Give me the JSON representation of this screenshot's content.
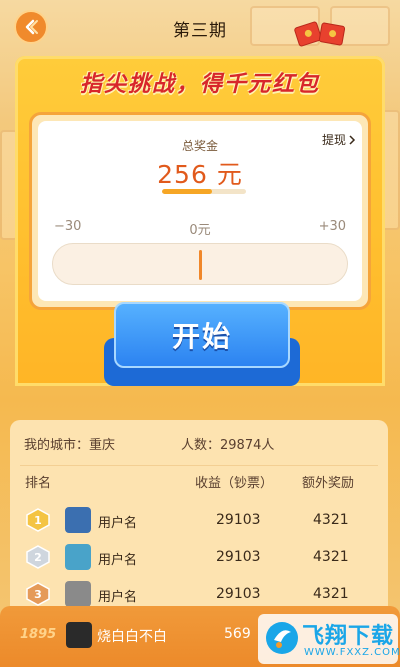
{
  "header": {
    "title": "第三期"
  },
  "game": {
    "headline": "指尖挑战，得千元红包",
    "total_label": "总奖金",
    "withdraw_label": "提现",
    "prize_amount": "256 元",
    "prize_progress": 0.6,
    "scale_min": "−30",
    "scale_mid": "0元",
    "scale_max": "+30",
    "slider_value": 0,
    "start_label": "开始"
  },
  "leaderboard": {
    "city_label": "我的城市：重庆",
    "count_label": "人数：29874人",
    "columns": {
      "rank": "排名",
      "earn": "收益（钞票）",
      "bonus": "额外奖励"
    },
    "rows": [
      {
        "rank": "1",
        "name": "用户名",
        "earn": "29103",
        "bonus": "4321",
        "medal_color": "#f4c443",
        "avatar_color": "#3b6fb0"
      },
      {
        "rank": "2",
        "name": "用户名",
        "earn": "29103",
        "bonus": "4321",
        "medal_color": "#cfd6de",
        "avatar_color": "#49a3c9"
      },
      {
        "rank": "3",
        "name": "用户名",
        "earn": "29103",
        "bonus": "4321",
        "medal_color": "#e59a58",
        "avatar_color": "#8a8a8a"
      }
    ]
  },
  "my_entry": {
    "rank": "1895",
    "name": "烧白白不白",
    "earn": "569"
  },
  "watermark": {
    "title": "飞翔下载",
    "url": "WWW.FXXZ.COM"
  },
  "colors": {
    "accent_orange": "#f0872a",
    "headline_red": "#d8262b",
    "start_blue": "#2c83f1",
    "machine_yellow": "#ffcc3a"
  }
}
